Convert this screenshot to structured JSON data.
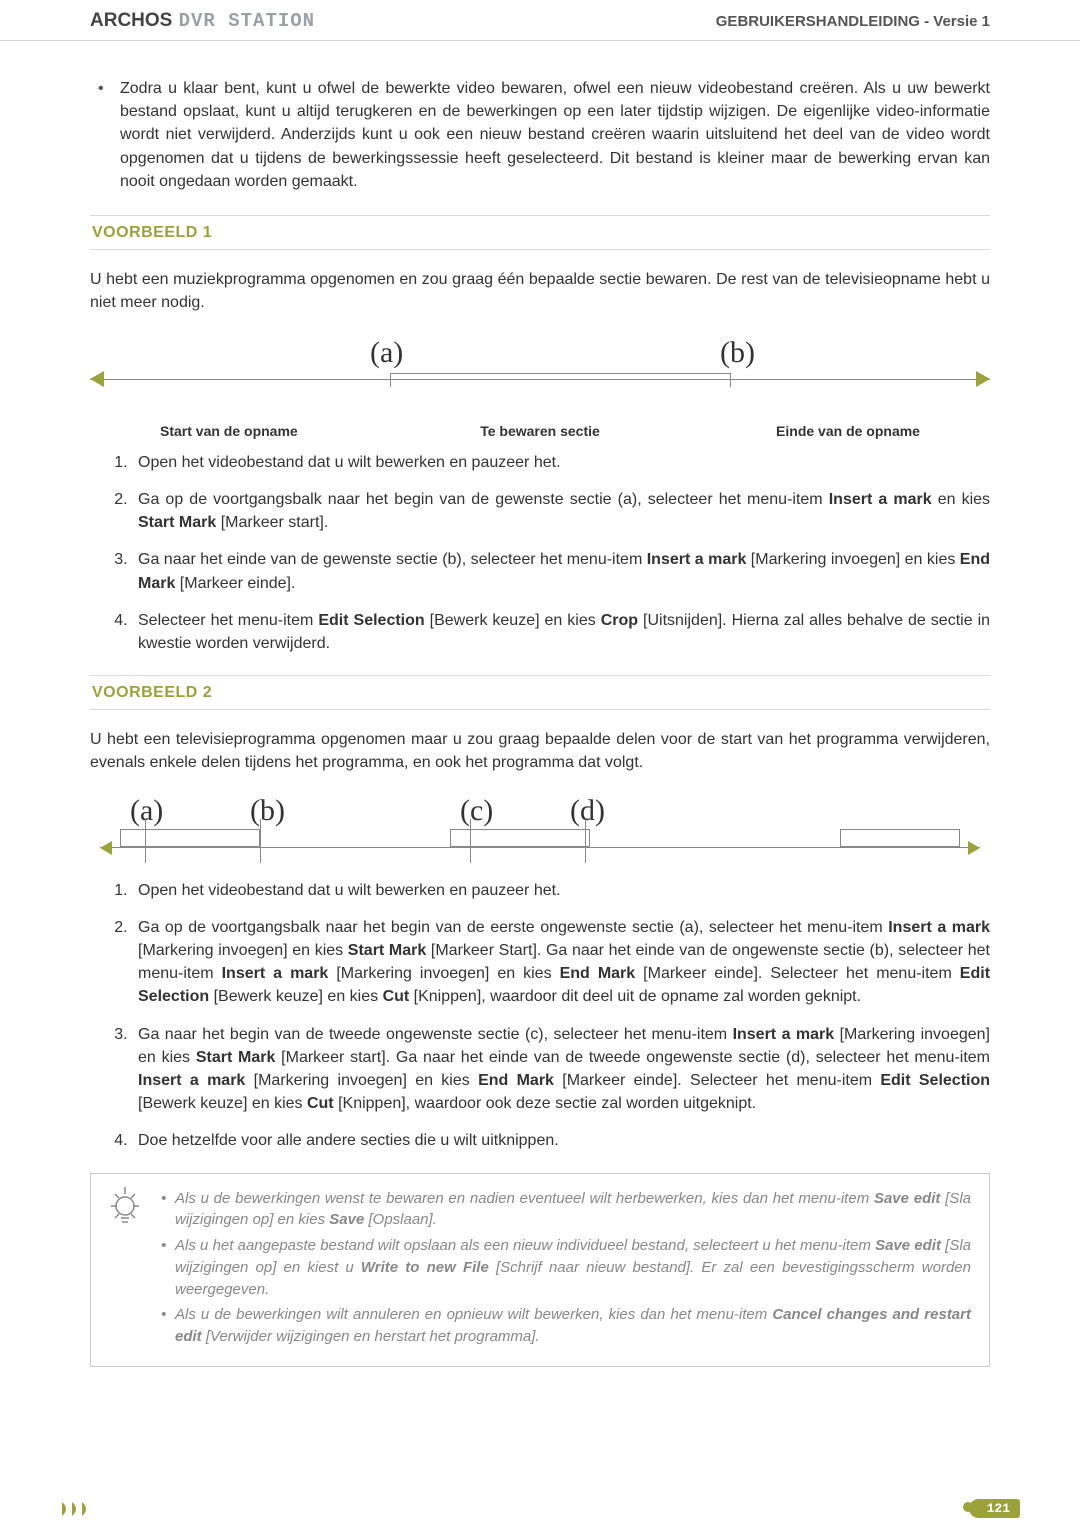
{
  "header": {
    "brand": "ARCHOS",
    "product": "DVR STATION",
    "doc_title": "GEBRUIKERSHANDLEIDING - Versie 1"
  },
  "intro_bullet": "Zodra u klaar bent, kunt u ofwel de bewerkte video bewaren, ofwel een nieuw videobestand creëren. Als u uw bewerkt bestand opslaat, kunt u altijd terugkeren en de bewerkingen op een later tijdstip wijzigen. De eigenlijke video-informatie wordt niet verwijderd. Anderzijds kunt u ook een nieuw bestand creëren waarin uitsluitend het deel van de video wordt opgenomen dat u tijdens de bewerkingssessie heeft geselecteerd. Dit bestand is kleiner maar de bewerking ervan kan nooit ongedaan worden gemaakt.",
  "ex1": {
    "title": "VOORBEELD 1",
    "lead": "U hebt een muziekprogramma opgenomen en zou graag één bepaalde sectie bewaren. De rest van de televisieopname hebt u niet meer nodig.",
    "label_a": "(a)",
    "label_b": "(b)",
    "cap_start": "Start van de opname",
    "cap_mid": "Te bewaren sectie",
    "cap_end": "Einde van de opname",
    "steps": {
      "s1": "Open het videobestand dat u wilt bewerken en pauzeer het.",
      "s2_a": "Ga op de voortgangsbalk naar het begin van de gewenste sectie (a), selecteer het menu-item ",
      "s2_b": "Insert a mark",
      "s2_c": " en kies ",
      "s2_d": "Start Mark",
      "s2_e": " [Markeer start].",
      "s3_a": "Ga naar het einde van de gewenste sectie (b), selecteer het menu-item ",
      "s3_b": "Insert a mark",
      "s3_c": " [Markering invoegen] en kies ",
      "s3_d": "End Mark",
      "s3_e": " [Markeer einde].",
      "s4_a": "Selecteer het menu-item ",
      "s4_b": "Edit Selection",
      "s4_c": " [Bewerk keuze] en kies ",
      "s4_d": "Crop",
      "s4_e": " [Uitsnijden]. Hierna zal alles behalve de sectie in kwestie worden verwijderd."
    }
  },
  "ex2": {
    "title": "VOORBEELD 2",
    "lead": "U hebt een televisieprogramma opgenomen maar u zou graag bepaalde delen voor de start van het programma verwijderen, evenals enkele delen tijdens het programma, en ook het programma dat volgt.",
    "label_a": "(a)",
    "label_b": "(b)",
    "label_c": "(c)",
    "label_d": "(d)",
    "steps": {
      "s1": "Open het videobestand dat u wilt bewerken en pauzeer het.",
      "s2_a": "Ga op de voortgangsbalk naar het begin van de eerste ongewenste sectie (a), selecteer het menu-item ",
      "s2_b": "Insert a mark",
      "s2_c": " [Markering invoegen] en kies ",
      "s2_d": "Start Mark",
      "s2_e": " [Markeer Start]. Ga naar het einde van de ongewenste sectie (b), selecteer het menu-item ",
      "s2_f": "Insert a mark",
      "s2_g": " [Markering invoegen] en kies ",
      "s2_h": "End Mark",
      "s2_i": " [Markeer einde]. Selecteer het menu-item ",
      "s2_j": "Edit Selection",
      "s2_k": " [Bewerk keuze] en kies ",
      "s2_l": "Cut",
      "s2_m": " [Knippen], waardoor dit deel uit de opname zal worden geknipt.",
      "s3_a": "Ga naar het begin van de tweede ongewenste sectie (c), selecteer het menu-item ",
      "s3_b": "Insert a mark",
      "s3_c": " [Markering invoegen] en kies ",
      "s3_d": "Start Mark",
      "s3_e": " [Markeer start]. Ga naar het einde van de tweede ongewenste sectie (d), selecteer het menu-item ",
      "s3_f": "Insert a mark",
      "s3_g": " [Markering invoegen] en kies ",
      "s3_h": "End Mark",
      "s3_i": " [Markeer einde]. Selecteer het menu-item ",
      "s3_j": "Edit Selection",
      "s3_k": " [Bewerk keuze] en kies ",
      "s3_l": "Cut",
      "s3_m": " [Knippen], waardoor ook deze sectie zal worden uitgeknipt.",
      "s4": "Doe hetzelfde voor alle andere secties die u wilt uitknippen."
    }
  },
  "tips": {
    "t1_a": "Als u de bewerkingen wenst te bewaren en nadien eventueel wilt herbewerken, kies dan het menu-item ",
    "t1_b": "Save edit",
    "t1_c": " [Sla wijzigingen op] en kies ",
    "t1_d": "Save",
    "t1_e": " [Opslaan].",
    "t2_a": "Als u het aangepaste bestand wilt opslaan als een nieuw individueel bestand, selecteert u het menu-item ",
    "t2_b": "Save edit",
    "t2_c": " [Sla wijzigingen op] en kiest u ",
    "t2_d": "Write to new File",
    "t2_e": " [Schrijf naar nieuw bestand]. Er zal een bevestigingsscherm worden weergegeven.",
    "t3_a": "Als u de bewerkingen wilt annuleren en opnieuw wilt bewerken, kies dan het menu-item ",
    "t3_b": "Cancel changes and restart edit",
    "t3_c": " [Verwijder wijzigingen en herstart het programma]."
  },
  "page_number": "121"
}
